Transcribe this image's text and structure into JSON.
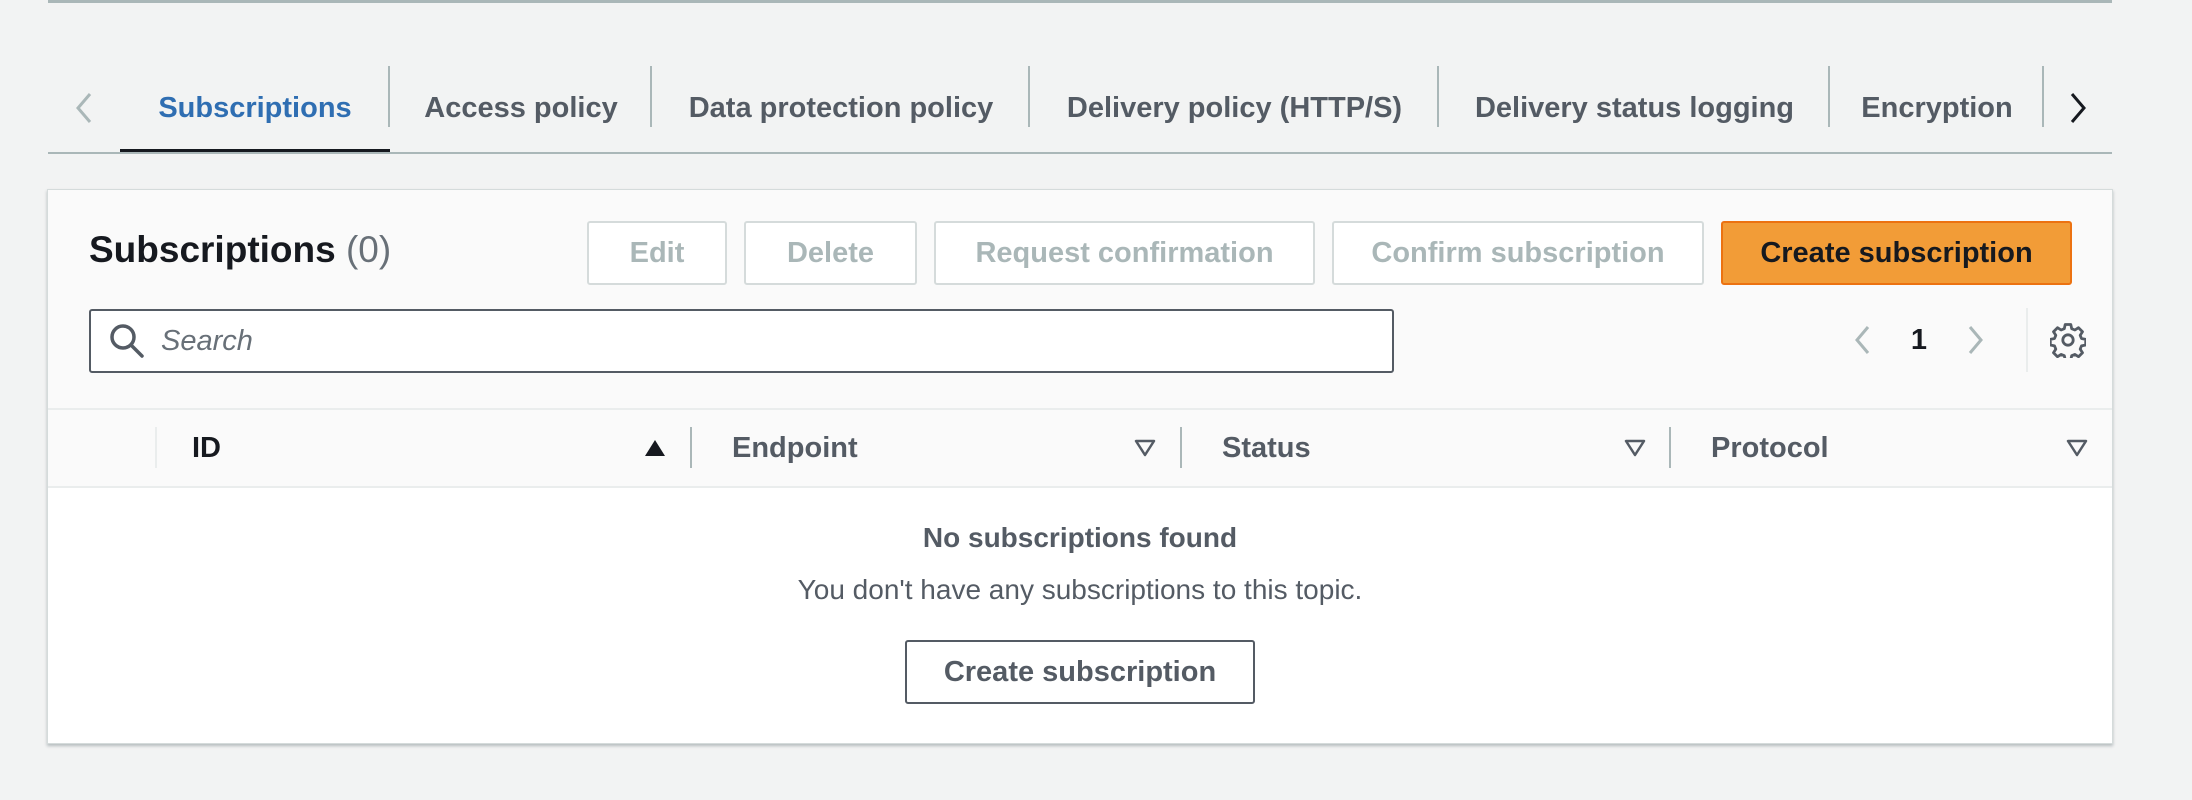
{
  "tabs": [
    {
      "label": "Subscriptions",
      "active": true
    },
    {
      "label": "Access policy",
      "active": false
    },
    {
      "label": "Data protection policy",
      "active": false
    },
    {
      "label": "Delivery policy (HTTP/S)",
      "active": false
    },
    {
      "label": "Delivery status logging",
      "active": false
    },
    {
      "label": "Encryption",
      "active": false
    }
  ],
  "subscriptions": {
    "title": "Subscriptions",
    "count": "(0)",
    "buttons": {
      "edit": "Edit",
      "delete": "Delete",
      "request_confirmation": "Request confirmation",
      "confirm_subscription": "Confirm subscription",
      "create_subscription": "Create subscription"
    },
    "search": {
      "placeholder": "Search",
      "value": ""
    },
    "pagination": {
      "current_page": "1"
    },
    "columns": [
      "ID",
      "Endpoint",
      "Status",
      "Protocol"
    ],
    "empty_state": {
      "title": "No subscriptions found",
      "message": "You don't have any subscriptions to this topic.",
      "button": "Create subscription"
    }
  },
  "colors": {
    "active_tab": "#2f6eb2",
    "primary_button": "#f29c37",
    "primary_button_border": "#ec7211",
    "disabled_text": "#aab7b8",
    "background": "#f2f3f3"
  },
  "icons": {
    "tab_scroll_left": "chevron-left-icon",
    "tab_scroll_right": "chevron-right-icon",
    "search": "search-icon",
    "pager_prev": "chevron-left-icon",
    "pager_next": "chevron-right-icon",
    "settings": "gear-icon",
    "sort_ascending": "caret-up-filled-icon",
    "sort_unsorted": "caret-down-outline-icon"
  }
}
